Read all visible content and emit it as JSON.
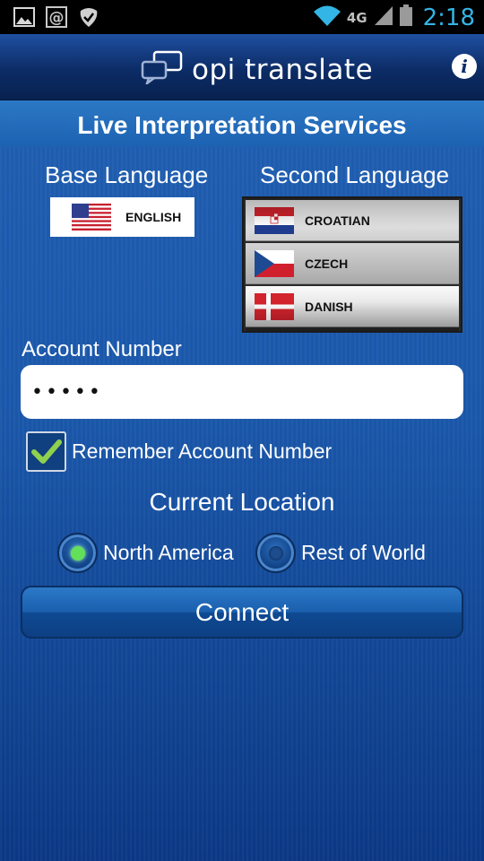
{
  "status_bar": {
    "time": "2:18",
    "network": "4G",
    "left_icons": [
      "gallery-icon",
      "email-icon",
      "task-check-icon"
    ],
    "right_icons": [
      "wifi-icon",
      "signal-icon",
      "battery-icon"
    ]
  },
  "header": {
    "app_name": "opi translate",
    "info_icon": "info-icon",
    "info_glyph": "i"
  },
  "banner": {
    "title": "Live Interpretation Services"
  },
  "languages": {
    "base_heading": "Base Language",
    "second_heading": "Second Language",
    "base": {
      "label": "ENGLISH",
      "flag": "us-flag-icon"
    },
    "second_options": [
      {
        "label": "CROATIAN",
        "flag": "croatia-flag-icon"
      },
      {
        "label": "CZECH",
        "flag": "czech-flag-icon",
        "selected": true
      },
      {
        "label": "DANISH",
        "flag": "denmark-flag-icon"
      }
    ]
  },
  "account": {
    "label": "Account Number",
    "value": "•••••",
    "remember_label": "Remember Account Number",
    "remember_checked": true
  },
  "location": {
    "heading": "Current Location",
    "options": [
      {
        "label": "North America",
        "selected": true
      },
      {
        "label": "Rest of World",
        "selected": false
      }
    ]
  },
  "connect_label": "Connect",
  "colors": {
    "background": "#1a57aa",
    "band": "#2c78c5",
    "title_bar": "#0c2c66",
    "status_icon": "#33b5e5",
    "radio_on": "#62e05a",
    "check_green": "#8fd14f"
  }
}
